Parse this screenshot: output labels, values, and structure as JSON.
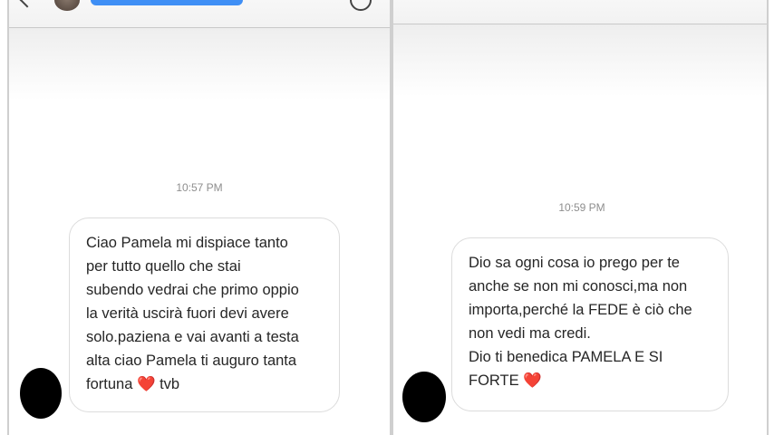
{
  "left_chat": {
    "timestamp": "10:57 PM",
    "message_lines": "Ciao Pamela mi dispiace tanto\nper tutto  quello  che stai\nsubendo vedrai che primo oppio\nla verità uscirà fuori devi avere\nsolo.paziena e vai avanti a testa\nalta ciao Pamela ti auguro tanta\nfortuna",
    "message_end": " tvb",
    "heart": "❤️"
  },
  "right_chat": {
    "timestamp": "10:59 PM",
    "message_lines": "Dio  sa ogni cosa io prego per te\nanche se non mi conosci,ma non\nimporta,perché la FEDE è ciò che\nnon vedi ma credi.\nDio ti benedica PAMELA E SI\nFORTE",
    "heart": "❤️"
  },
  "colors": {
    "redaction_blue": "#3f8ff5",
    "bubble_border": "#dcdcdc",
    "timestamp_gray": "#8e8e8e"
  },
  "icons": [
    "back-arrow-icon",
    "info-icon"
  ]
}
